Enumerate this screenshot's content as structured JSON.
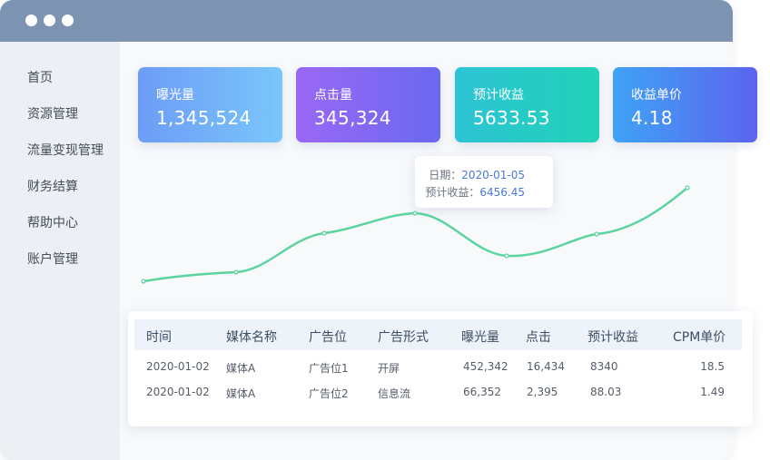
{
  "sidebar": {
    "items": [
      {
        "label": "首页"
      },
      {
        "label": "资源管理"
      },
      {
        "label": "流量变现管理"
      },
      {
        "label": "财务结算"
      },
      {
        "label": "帮助中心"
      },
      {
        "label": "账户管理"
      }
    ]
  },
  "cards": [
    {
      "label": "曝光量",
      "value": "1,345,524"
    },
    {
      "label": "点击量",
      "value": "345,324"
    },
    {
      "label": "预计收益",
      "value": "5633.53"
    },
    {
      "label": "收益单价",
      "value": "4.18"
    }
  ],
  "tooltip": {
    "date_label": "日期：",
    "date_value": "2020-01-05",
    "revenue_label": "预计收益：",
    "revenue_value": "6456.45"
  },
  "table": {
    "headers": [
      "时间",
      "媒体名称",
      "广告位",
      "广告形式",
      "曝光量",
      "点击",
      "预计收益",
      "CPM单价"
    ],
    "rows": [
      [
        "2020-01-02",
        "媒体A",
        "广告位1",
        "开屏",
        "452,342",
        "16,434",
        "8340",
        "18.5"
      ],
      [
        "2020-01-02",
        "媒体A",
        "广告位2",
        "信息流",
        "66,352",
        "2,395",
        "88.03",
        "1.49"
      ]
    ]
  },
  "colors": {
    "titlebar": "#7d93b2",
    "line": "#5cd49f",
    "accent": "#4a78d8"
  }
}
